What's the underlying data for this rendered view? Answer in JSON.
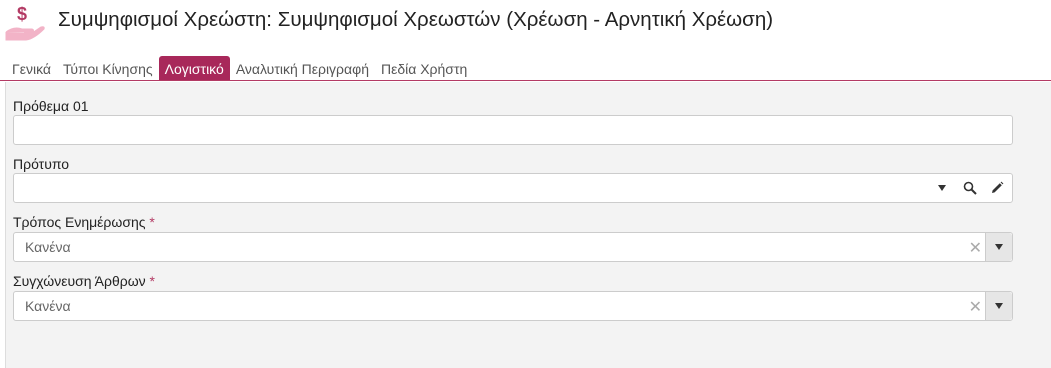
{
  "header": {
    "title": "Συμψηφισμοί Χρεώστη: Συμψηφισμοί Χρεωστών (Χρέωση - Αρνητική Χρέωση)",
    "icon": "money-hand-icon",
    "accent_color": "#a8285a"
  },
  "tabs": [
    {
      "label": "Γενικά",
      "active": false
    },
    {
      "label": "Τύποι Κίνησης",
      "active": false
    },
    {
      "label": "Λογιστικό",
      "active": true
    },
    {
      "label": "Αναλυτική Περιγραφή",
      "active": false
    },
    {
      "label": "Πεδία Χρήστη",
      "active": false
    }
  ],
  "form": {
    "prefix": {
      "label": "Πρόθεμα 01",
      "value": ""
    },
    "template": {
      "label": "Πρότυπο",
      "value": ""
    },
    "update_mode": {
      "label": "Τρόπος Ενημέρωσης",
      "required_mark": "*",
      "value": "Κανένα"
    },
    "merge_entries": {
      "label": "Συγχώνευση Άρθρων",
      "required_mark": "*",
      "value": "Κανένα"
    }
  }
}
